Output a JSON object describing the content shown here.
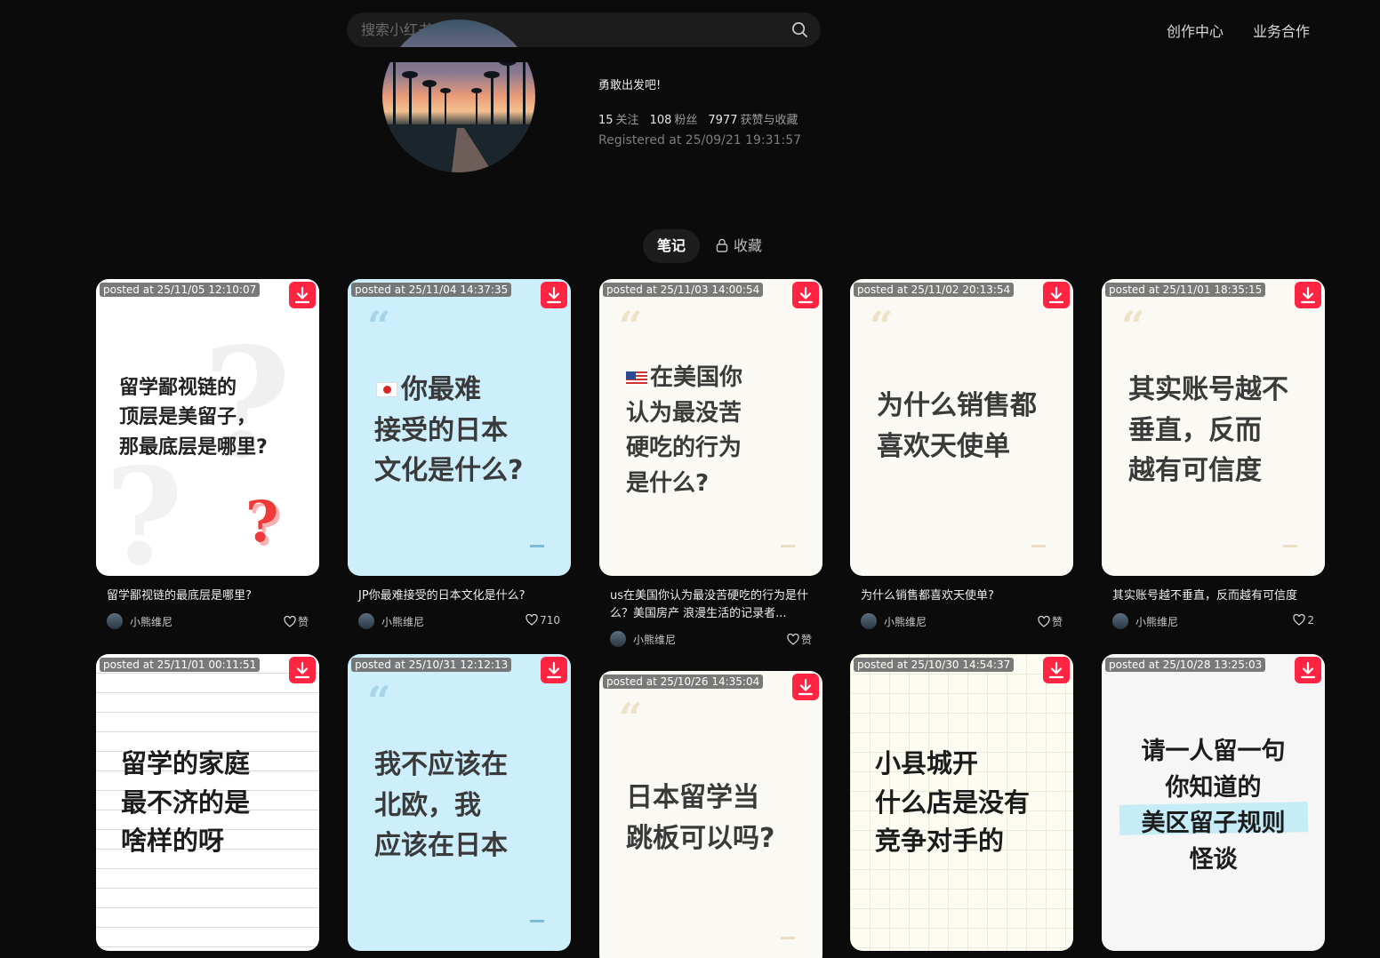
{
  "header": {
    "search_placeholder": "搜索小红书",
    "nav": [
      "创作中心",
      "业务合作"
    ]
  },
  "profile": {
    "bio": "勇敢出发吧!",
    "following_count": "15",
    "following_label": "关注",
    "followers_count": "108",
    "followers_label": "粉丝",
    "likes_count": "7977",
    "likes_label": "获赞与收藏",
    "registered": "Registered at 25/09/21 19:31:57"
  },
  "tabs": {
    "notes": "笔记",
    "favorites": "收藏"
  },
  "author": "小熊维尼",
  "cards": [
    {
      "posted": "posted at 25/11/05 12:10:07",
      "cover_text": "留学鄙视链的\n顶层是美留子，\n那最底层是哪里?",
      "title": "留学鄙视链的最底层是哪里?",
      "likes": "赞"
    },
    {
      "posted": "posted at 25/11/04 14:37:35",
      "cover_text": "你最难\n接受的日本\n文化是什么?",
      "title": "JP你最难接受的日本文化是什么?",
      "likes": "710"
    },
    {
      "posted": "posted at 25/11/03 14:00:54",
      "cover_text": "在美国你\n认为最没苦\n硬吃的行为\n是什么?",
      "title": "us在美国你认为最没苦硬吃的行为是什么？美国房产 浪漫生活的记录者...",
      "likes": "赞"
    },
    {
      "posted": "posted at 25/11/02 20:13:54",
      "cover_text": "为什么销售都\n喜欢天使单",
      "title": "为什么销售都喜欢天使单?",
      "likes": "赞"
    },
    {
      "posted": "posted at 25/11/01 18:35:15",
      "cover_text": "其实账号越不\n垂直，反而\n越有可信度",
      "title": "其实账号越不垂直，反而越有可信度",
      "likes": "2"
    },
    {
      "posted": "posted at 25/11/01 00:11:51",
      "cover_text": "留学的家庭\n最不济的是\n啥样的呀"
    },
    {
      "posted": "posted at 25/10/31 12:12:13",
      "cover_text": "我不应该在\n北欧，我\n应该在日本"
    },
    {
      "posted": "posted at 25/10/26 14:35:04",
      "cover_text": "日本留学当\n跳板可以吗?"
    },
    {
      "posted": "posted at 25/10/30 14:54:37",
      "cover_text": "小县城开\n什么店是没有\n竞争对手的"
    },
    {
      "posted": "posted at 25/10/28 13:25:03",
      "cover_text": "请一人留一句\n你知道的\n美区留子规则\n怪谈"
    }
  ],
  "colors": {
    "accent": "#ff2442",
    "background": "#0b0b0b"
  }
}
